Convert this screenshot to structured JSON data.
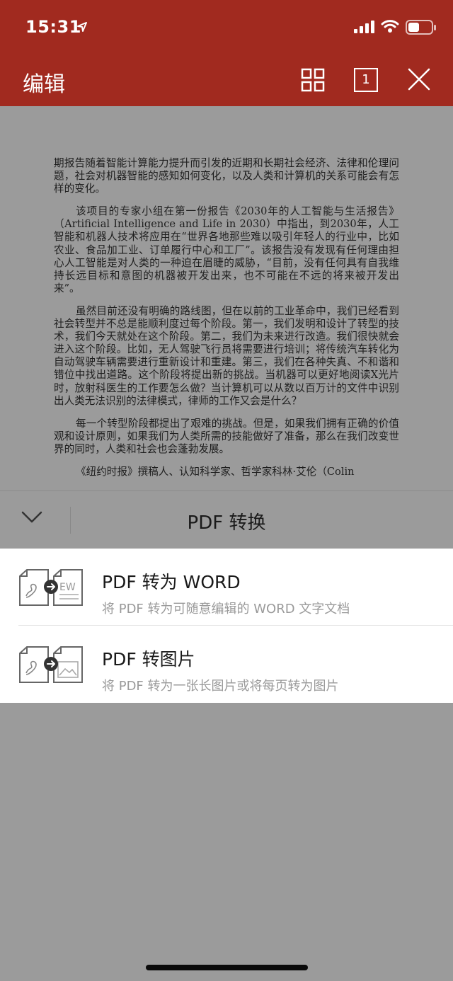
{
  "status_bar": {
    "time": "15:31"
  },
  "app_bar": {
    "title": "编辑",
    "page_number": "1"
  },
  "document": {
    "paragraphs": [
      "期报告随着智能计算能力提升而引发的近期和长期社会经济、法律和伦理问题，社会对机器智能的感知如何变化，以及人类和计算机的关系可能会有怎样的变化。",
      "该项目的专家小组在第一份报告《2030年的人工智能与生活报告》（Artificial Intelligence and Life in 2030）中指出，到2030年，人工智能和机器人技术将应用在“世界各地那些难以吸引年轻人的行业中，比如农业、食品加工业、订单履行中心和工厂”。该报告没有发现有任何理由担心人工智能是对人类的一种迫在眉睫的威胁，“目前，没有任何具有自我维持长远目标和意图的机器被开发出来，也不可能在不远的将来被开发出来”。",
      "虽然目前还没有明确的路线图，但在以前的工业革命中，我们已经看到社会转型并不总是能顺利度过每个阶段。第一，我们发明和设计了转型的技术，我们今天就处在这个阶段。第二，我们为未来进行改造。我们很快就会进入这个阶段。比如，无人驾驶飞行员将需要进行培训；将传统汽车转化为自动驾驶车辆需要进行重新设计和重建。第三，我们在各种失真、不和谐和错位中找出道路。这个阶段将提出新的挑战。当机器可以更好地阅读X光片时，放射科医生的工作要怎么做？当计算机可以从数以百万计的文件中识别出人类无法识别的法律模式，律师的工作又会是什么？",
      "每一个转型阶段都提出了艰难的挑战。但是，如果我们拥有正确的价值观和设计原则，如果我们为人类所需的技能做好了准备，那么在我们改变世界的同时，人类和社会也会蓬勃发展。",
      "《纽约时报》撰稿人、认知科学家、哲学家科林·艾伦（Colin"
    ]
  },
  "sheet": {
    "title": "PDF 转换",
    "options": [
      {
        "title": "PDF 转为 WORD",
        "subtitle": "将 PDF 转为可随意编辑的 WORD 文字文档"
      },
      {
        "title": "PDF 转图片",
        "subtitle": "将 PDF 转为一张长图片或将每页转为图片"
      }
    ]
  },
  "colors": {
    "header": "#a12a1f",
    "dim_overlay": "#9b9b9b",
    "sheet_bg": "#ffffff"
  }
}
